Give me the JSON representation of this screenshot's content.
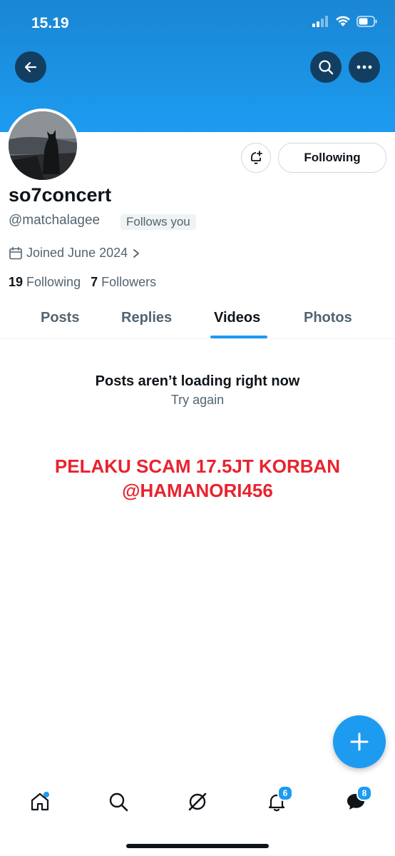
{
  "status_bar": {
    "time": "15.19"
  },
  "profile": {
    "display_name": "so7concert",
    "handle": "@matchalagee",
    "follows_you_badge": "Follows you",
    "joined": "Joined June 2024",
    "following_count": "19",
    "following_label": "Following",
    "followers_count": "7",
    "followers_label": "Followers",
    "follow_button_label": "Following"
  },
  "tabs": [
    "Posts",
    "Replies",
    "Videos",
    "Photos"
  ],
  "active_tab": "Videos",
  "feed": {
    "error_title": "Posts aren’t loading right now",
    "retry_label": "Try again"
  },
  "overlay": {
    "line1": "PELAKU SCAM 17.5JT KORBAN",
    "line2": "@HAMANORI456"
  },
  "bottom_nav": {
    "items": [
      "home-icon",
      "search-icon",
      "grok-icon",
      "bell-icon",
      "messages-icon"
    ],
    "notifications_badge": "6",
    "messages_badge": "8"
  },
  "colors": {
    "accent": "#1d9bf0",
    "overlay_text": "#e8232f",
    "banner": "#1d9bf0"
  }
}
